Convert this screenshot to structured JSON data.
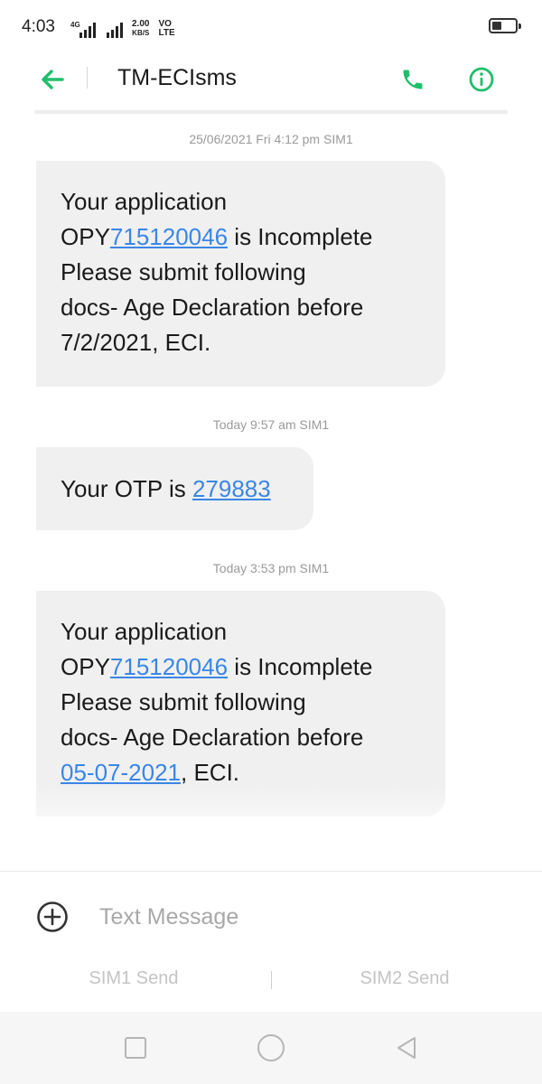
{
  "status_bar": {
    "time": "4:03",
    "network_type": "4G",
    "data_speed_value": "2.00",
    "data_speed_unit": "KB/S",
    "volte_top": "VO",
    "volte_bottom": "LTE",
    "battery_level": 0.4
  },
  "app_bar": {
    "contact_name": "TM-ECIsms",
    "back_icon": "arrow-left-icon",
    "call_icon": "phone-icon",
    "info_icon": "info-circle-icon",
    "accent_color": "#1fbf6a"
  },
  "messages": [
    {
      "timestamp": "25/06/2021 Fri 4:12 pm  SIM1",
      "line1": "Your application",
      "prefix": "OPY",
      "app_number": "715120046",
      "line2_suffix": " is Incomplete",
      "line3": "Please submit following",
      "line4": "docs-  Age Declaration before",
      "date_text": "7/2/2021",
      "tail": ", ECI."
    },
    {
      "timestamp": "Today 9:57 am  SIM1",
      "otp_prefix": "Your OTP is ",
      "otp_code": "279883"
    },
    {
      "timestamp": "Today 3:53 pm  SIM1",
      "line1": "Your application",
      "prefix": "OPY",
      "app_number": "715120046",
      "line2_suffix": " is Incomplete",
      "line3": "Please submit following",
      "line4": "docs-  Age Declaration before",
      "date_link": "05-07-2021",
      "tail": ", ECI."
    }
  ],
  "compose": {
    "add_icon": "plus-circle-icon",
    "placeholder": "Text Message",
    "sim1_send": "SIM1 Send",
    "sim2_send": "SIM2 Send"
  },
  "nav_bar": {
    "recents_icon": "square-icon",
    "home_icon": "circle-icon",
    "back_icon": "triangle-back-icon"
  },
  "colors": {
    "link": "#3a86e6",
    "bubble": "#f0f0f0",
    "timestamp": "#9a9a9a"
  }
}
